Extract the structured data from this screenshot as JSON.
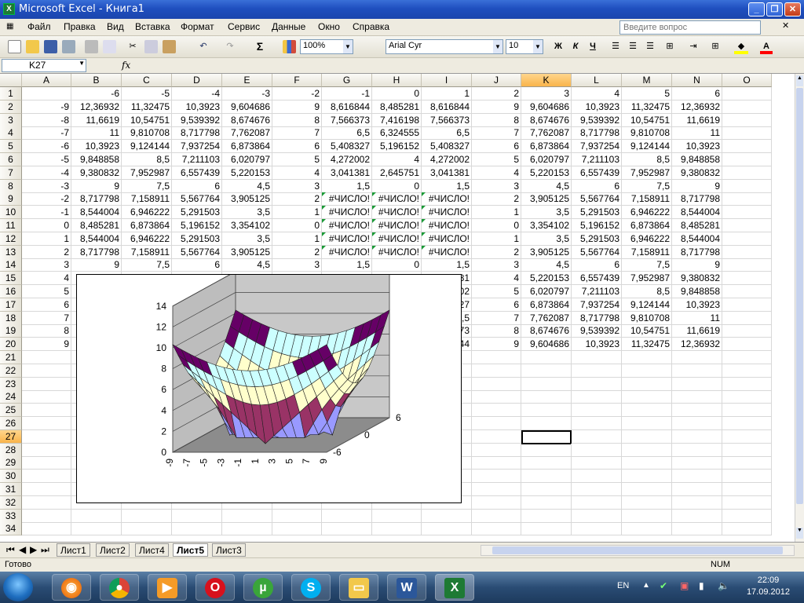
{
  "window": {
    "title": "Microsoft Excel - Книга1",
    "controls": [
      "_",
      "❐",
      "✕"
    ]
  },
  "menu": {
    "items": [
      "Файл",
      "Правка",
      "Вид",
      "Вставка",
      "Формат",
      "Сервис",
      "Данные",
      "Окно",
      "Справка"
    ],
    "help_placeholder": "Введите вопрос"
  },
  "toolbar": {
    "zoom": "100%",
    "font": "Arial Cyr",
    "size": "10",
    "bold": "Ж",
    "italic": "К",
    "underline": "Ч",
    "sigma": "Σ"
  },
  "formula": {
    "name_box": "K27",
    "fx": "fx",
    "content": ""
  },
  "columns": [
    "A",
    "B",
    "C",
    "D",
    "E",
    "F",
    "G",
    "H",
    "I",
    "J",
    "K",
    "L",
    "M",
    "N",
    "O"
  ],
  "selected_cell": {
    "col": "K",
    "row": "27"
  },
  "rows": [
    [
      "",
      "-6",
      "-5",
      "-4",
      "-3",
      "-2",
      "-1",
      "0",
      "1",
      "2",
      "3",
      "4",
      "5",
      "6",
      ""
    ],
    [
      "-9",
      "12,36932",
      "11,32475",
      "10,3923",
      "9,604686",
      "9",
      "8,616844",
      "8,485281",
      "8,616844",
      "9",
      "9,604686",
      "10,3923",
      "11,32475",
      "12,36932",
      ""
    ],
    [
      "-8",
      "11,6619",
      "10,54751",
      "9,539392",
      "8,674676",
      "8",
      "7,566373",
      "7,416198",
      "7,566373",
      "8",
      "8,674676",
      "9,539392",
      "10,54751",
      "11,6619",
      ""
    ],
    [
      "-7",
      "11",
      "9,810708",
      "8,717798",
      "7,762087",
      "7",
      "6,5",
      "6,324555",
      "6,5",
      "7",
      "7,762087",
      "8,717798",
      "9,810708",
      "11",
      ""
    ],
    [
      "-6",
      "10,3923",
      "9,124144",
      "7,937254",
      "6,873864",
      "6",
      "5,408327",
      "5,196152",
      "5,408327",
      "6",
      "6,873864",
      "7,937254",
      "9,124144",
      "10,3923",
      ""
    ],
    [
      "-5",
      "9,848858",
      "8,5",
      "7,211103",
      "6,020797",
      "5",
      "4,272002",
      "4",
      "4,272002",
      "5",
      "6,020797",
      "7,211103",
      "8,5",
      "9,848858",
      ""
    ],
    [
      "-4",
      "9,380832",
      "7,952987",
      "6,557439",
      "5,220153",
      "4",
      "3,041381",
      "2,645751",
      "3,041381",
      "4",
      "5,220153",
      "6,557439",
      "7,952987",
      "9,380832",
      ""
    ],
    [
      "-3",
      "9",
      "7,5",
      "6",
      "4,5",
      "3",
      "1,5",
      "0",
      "1,5",
      "3",
      "4,5",
      "6",
      "7,5",
      "9",
      ""
    ],
    [
      "-2",
      "8,717798",
      "7,158911",
      "5,567764",
      "3,905125",
      "2",
      "#ЧИСЛО!",
      "#ЧИСЛО!",
      "#ЧИСЛО!",
      "2",
      "3,905125",
      "5,567764",
      "7,158911",
      "8,717798",
      ""
    ],
    [
      "-1",
      "8,544004",
      "6,946222",
      "5,291503",
      "3,5",
      "1",
      "#ЧИСЛО!",
      "#ЧИСЛО!",
      "#ЧИСЛО!",
      "1",
      "3,5",
      "5,291503",
      "6,946222",
      "8,544004",
      ""
    ],
    [
      "0",
      "8,485281",
      "6,873864",
      "5,196152",
      "3,354102",
      "0",
      "#ЧИСЛО!",
      "#ЧИСЛО!",
      "#ЧИСЛО!",
      "0",
      "3,354102",
      "5,196152",
      "6,873864",
      "8,485281",
      ""
    ],
    [
      "1",
      "8,544004",
      "6,946222",
      "5,291503",
      "3,5",
      "1",
      "#ЧИСЛО!",
      "#ЧИСЛО!",
      "#ЧИСЛО!",
      "1",
      "3,5",
      "5,291503",
      "6,946222",
      "8,544004",
      ""
    ],
    [
      "2",
      "8,717798",
      "7,158911",
      "5,567764",
      "3,905125",
      "2",
      "#ЧИСЛО!",
      "#ЧИСЛО!",
      "#ЧИСЛО!",
      "2",
      "3,905125",
      "5,567764",
      "7,158911",
      "8,717798",
      ""
    ],
    [
      "3",
      "9",
      "7,5",
      "6",
      "4,5",
      "3",
      "1,5",
      "0",
      "1,5",
      "3",
      "4,5",
      "6",
      "7,5",
      "9",
      ""
    ],
    [
      "4",
      "",
      "",
      "",
      "",
      "",
      "",
      "",
      "81",
      "4",
      "5,220153",
      "6,557439",
      "7,952987",
      "9,380832",
      ""
    ],
    [
      "5",
      "",
      "",
      "",
      "",
      "",
      "",
      "",
      "02",
      "5",
      "6,020797",
      "7,211103",
      "8,5",
      "9,848858",
      ""
    ],
    [
      "6",
      "",
      "",
      "",
      "",
      "",
      "",
      "",
      "27",
      "6",
      "6,873864",
      "7,937254",
      "9,124144",
      "10,3923",
      ""
    ],
    [
      "7",
      "",
      "",
      "",
      "",
      "",
      "",
      "",
      "5,5",
      "7",
      "7,762087",
      "8,717798",
      "9,810708",
      "11",
      ""
    ],
    [
      "8",
      "",
      "",
      "",
      "",
      "",
      "",
      "",
      "73",
      "8",
      "8,674676",
      "9,539392",
      "10,54751",
      "11,6619",
      ""
    ],
    [
      "9",
      "",
      "",
      "",
      "",
      "",
      "",
      "",
      "44",
      "9",
      "9,604686",
      "10,3923",
      "11,32475",
      "12,36932",
      ""
    ]
  ],
  "chart_data": {
    "type": "surface",
    "x": [
      -9,
      -7,
      -5,
      -3,
      -1,
      1,
      3,
      5,
      7,
      9
    ],
    "x_tick_labels": [
      "-9",
      "-7",
      "-5",
      "-3",
      "-1",
      "1",
      "3",
      "5",
      "7",
      "9"
    ],
    "y_tick_labels": [
      "6",
      "0",
      "-6"
    ],
    "z_tick_labels": [
      "0",
      "2",
      "4",
      "6",
      "8",
      "10",
      "12",
      "14"
    ],
    "zlim": [
      0,
      14
    ],
    "band_colors": [
      "#9999ff",
      "#993366",
      "#ffffcc",
      "#ccffff",
      "#660066",
      "#ff8080",
      "#0066cc",
      "#ccccff"
    ]
  },
  "sheets": [
    "Лист1",
    "Лист2",
    "Лист4",
    "Лист5",
    "Лист3"
  ],
  "active_sheet": "Лист5",
  "status": {
    "left": "Готово",
    "num": "NUM"
  },
  "taskbar": {
    "lang": "EN",
    "time": "22:09",
    "date": "17.09.2012"
  }
}
